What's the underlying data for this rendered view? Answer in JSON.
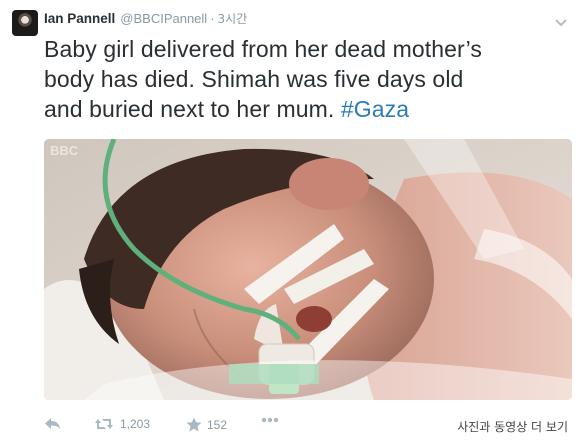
{
  "author": {
    "name": "Ian Pannell",
    "handle": "@BBCIPannell",
    "timestamp": "3시간"
  },
  "tweet": {
    "line1": "Baby girl delivered from her dead mother’s",
    "line2": "body has died. Shimah was five days old",
    "line3_text": "and buried next to her mum. ",
    "hashtag": "#Gaza"
  },
  "media": {
    "watermark": "BBC"
  },
  "actions": {
    "retweet_count": "1,203",
    "favorite_count": "152",
    "view_more_label": "사진과 동영상 더 보기"
  },
  "icons": {
    "reply": "reply-icon",
    "retweet": "retweet-icon",
    "favorite": "star-icon",
    "more": "more-dots-icon",
    "caret": "chevron-down-icon"
  },
  "colors": {
    "link": "#2b7bb9",
    "muted": "#8899a6",
    "text": "#292f33"
  }
}
